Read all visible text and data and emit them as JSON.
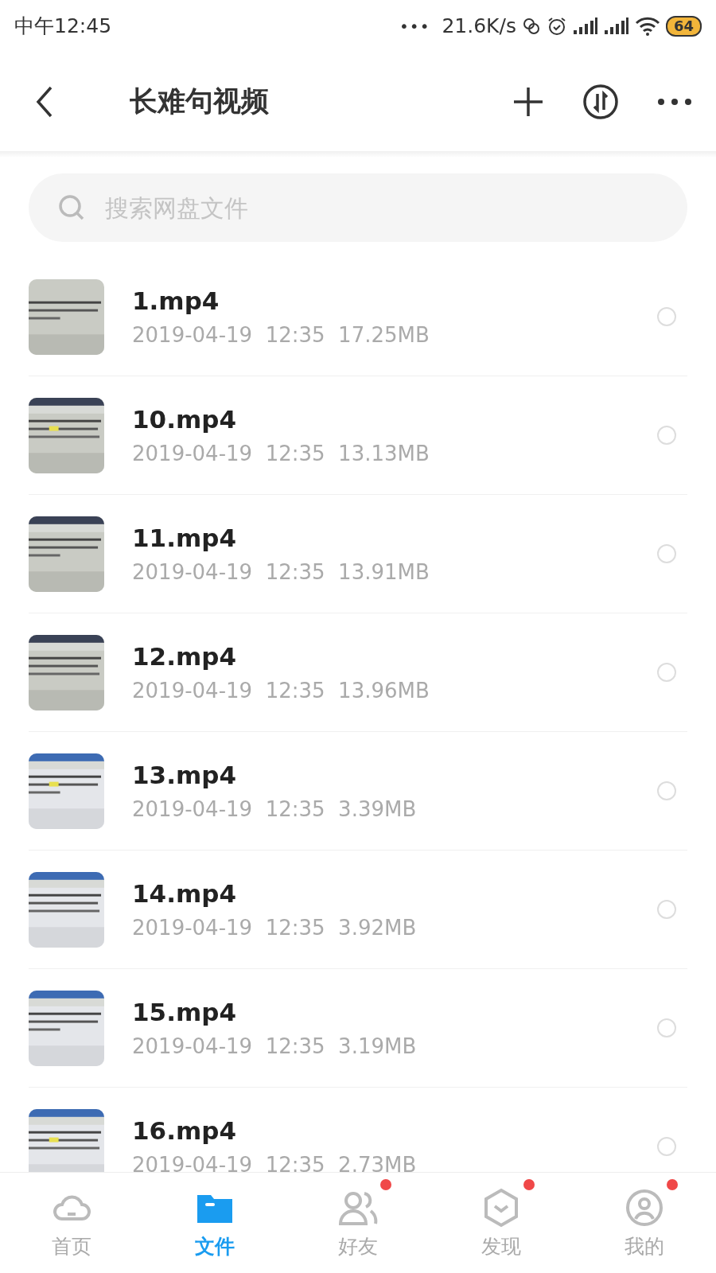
{
  "status_bar": {
    "time": "中午12:45",
    "more": "•••",
    "speed": "21.6K/s",
    "battery": "64"
  },
  "header": {
    "title": "长难句视频"
  },
  "search": {
    "placeholder": "搜索网盘文件"
  },
  "files": [
    {
      "name": "1.mp4",
      "date": "2019-04-19  12:35",
      "size": "17.25MB",
      "selected": false
    },
    {
      "name": "10.mp4",
      "date": "2019-04-19  12:35",
      "size": "13.13MB",
      "selected": false
    },
    {
      "name": "11.mp4",
      "date": "2019-04-19  12:35",
      "size": "13.91MB",
      "selected": false
    },
    {
      "name": "12.mp4",
      "date": "2019-04-19  12:35",
      "size": "13.96MB",
      "selected": false
    },
    {
      "name": "13.mp4",
      "date": "2019-04-19  12:35",
      "size": "3.39MB",
      "selected": false
    },
    {
      "name": "14.mp4",
      "date": "2019-04-19  12:35",
      "size": "3.92MB",
      "selected": false
    },
    {
      "name": "15.mp4",
      "date": "2019-04-19  12:35",
      "size": "3.19MB",
      "selected": false
    },
    {
      "name": "16.mp4",
      "date": "2019-04-19  12:35",
      "size": "2.73MB",
      "selected": false
    }
  ],
  "tab_bar": [
    {
      "label": "首页",
      "kind": "cloud",
      "selected": false,
      "badge": false
    },
    {
      "label": "文件",
      "kind": "folder",
      "selected": true,
      "badge": false
    },
    {
      "label": "好友",
      "kind": "friends",
      "selected": false,
      "badge": true
    },
    {
      "label": "发现",
      "kind": "discover",
      "selected": false,
      "badge": true
    },
    {
      "label": "我的",
      "kind": "me",
      "selected": false,
      "badge": true
    }
  ]
}
